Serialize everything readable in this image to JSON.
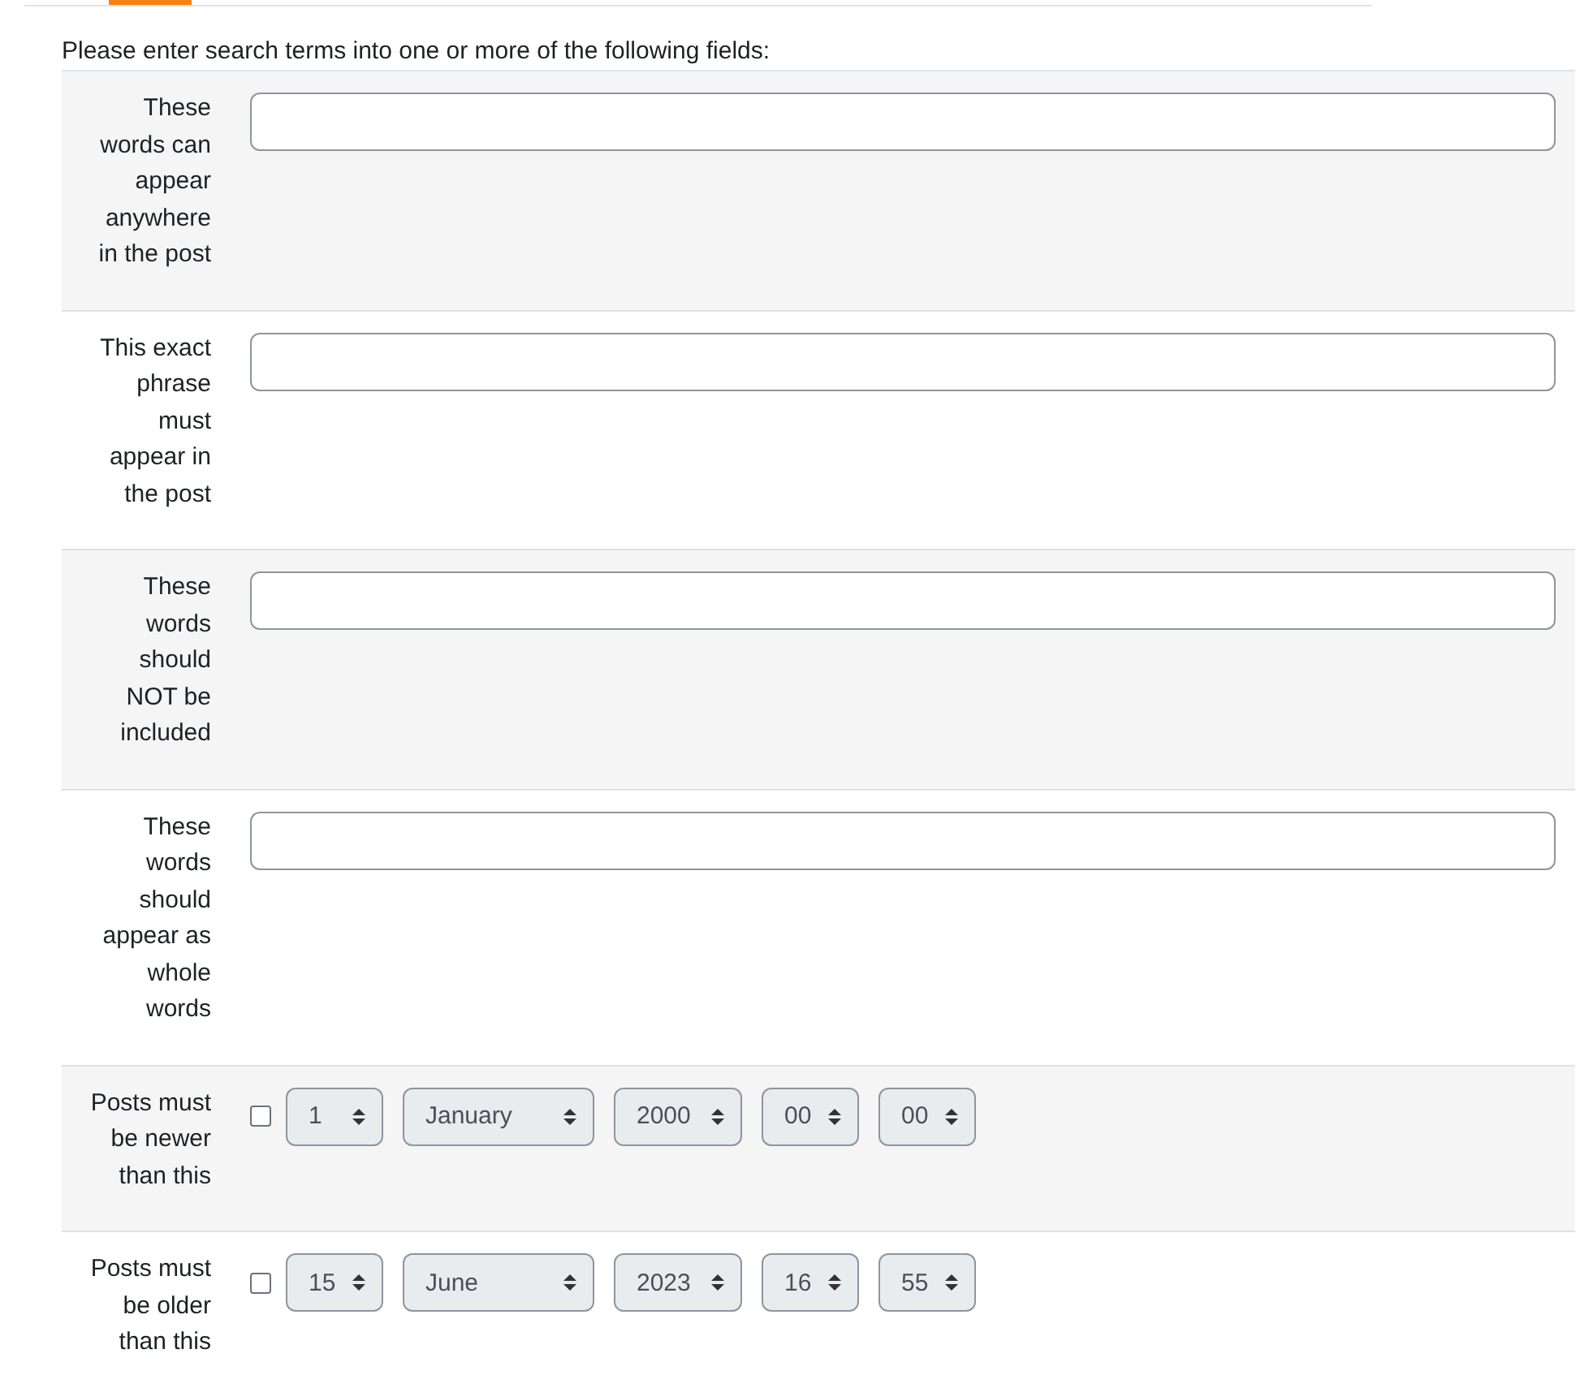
{
  "intro": "Please enter search terms into one or more of the following fields:",
  "rows": [
    {
      "kind": "text",
      "label": "These words can appear anywhere in the post"
    },
    {
      "kind": "text",
      "label": "This exact phrase must appear in the post"
    },
    {
      "kind": "text",
      "label": "These words should NOT be included"
    },
    {
      "kind": "text",
      "label": "These words should appear as whole words"
    },
    {
      "kind": "date",
      "label": "Posts must be newer than this",
      "checked": false,
      "day": "1",
      "month": "January",
      "year": "2000",
      "hour": "00",
      "minute": "00"
    },
    {
      "kind": "date",
      "label": "Posts must be older than this",
      "checked": false,
      "day": "15",
      "month": "June",
      "year": "2023",
      "hour": "16",
      "minute": "55"
    }
  ]
}
